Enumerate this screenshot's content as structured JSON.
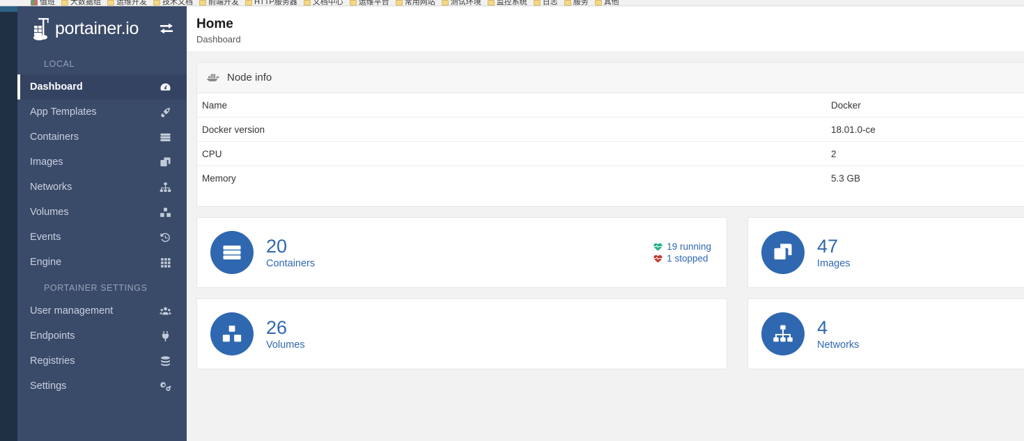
{
  "browser": {
    "bookmarks": [
      {
        "label": "值班",
        "icon": "multicolor-icon"
      },
      {
        "label": "大数据组",
        "icon": "folder-icon"
      },
      {
        "label": "运维开发",
        "icon": "folder-icon"
      },
      {
        "label": "技术文档",
        "icon": "folder-icon"
      },
      {
        "label": "前端开发",
        "icon": "folder-icon"
      },
      {
        "label": "HTTP服务器",
        "icon": "folder-icon"
      },
      {
        "label": "文档中心",
        "icon": "folder-icon"
      },
      {
        "label": "运维平台",
        "icon": "folder-icon"
      },
      {
        "label": "常用网站",
        "icon": "folder-icon"
      },
      {
        "label": "测试环境",
        "icon": "folder-icon"
      },
      {
        "label": "监控系统",
        "icon": "folder-icon"
      },
      {
        "label": "日志",
        "icon": "folder-icon"
      },
      {
        "label": "服务",
        "icon": "folder-icon"
      },
      {
        "label": "其他",
        "icon": "folder-icon"
      }
    ]
  },
  "sidebar": {
    "brand": "portainer.io",
    "toggle_icon": "exchange-arrows-icon",
    "sections": [
      {
        "title": "LOCAL",
        "items": [
          {
            "label": "Dashboard",
            "icon": "tachometer-icon",
            "active": true
          },
          {
            "label": "App Templates",
            "icon": "rocket-icon",
            "active": false
          },
          {
            "label": "Containers",
            "icon": "server-stack-icon",
            "active": false
          },
          {
            "label": "Images",
            "icon": "clone-icon",
            "active": false
          },
          {
            "label": "Networks",
            "icon": "sitemap-icon",
            "active": false
          },
          {
            "label": "Volumes",
            "icon": "cubes-icon",
            "active": false
          },
          {
            "label": "Events",
            "icon": "history-icon",
            "active": false
          },
          {
            "label": "Engine",
            "icon": "grid-icon",
            "active": false
          }
        ]
      },
      {
        "title": "PORTAINER SETTINGS",
        "items": [
          {
            "label": "User management",
            "icon": "users-icon",
            "active": false
          },
          {
            "label": "Endpoints",
            "icon": "plug-icon",
            "active": false
          },
          {
            "label": "Registries",
            "icon": "database-icon",
            "active": false
          },
          {
            "label": "Settings",
            "icon": "cogs-icon",
            "active": false
          }
        ]
      }
    ]
  },
  "header": {
    "title": "Home",
    "breadcrumb": "Dashboard"
  },
  "node_info": {
    "panel_title": "Node info",
    "panel_icon": "docker-whale-icon",
    "rows": [
      {
        "key": "Name",
        "value": "Docker"
      },
      {
        "key": "Docker version",
        "value": "18.01.0-ce"
      },
      {
        "key": "CPU",
        "value": "2"
      },
      {
        "key": "Memory",
        "value": "5.3 GB"
      }
    ]
  },
  "cards": [
    {
      "count": "20",
      "label": "Containers",
      "icon": "server-stack-icon",
      "status": [
        {
          "text": "19 running",
          "icon": "heartbeat-icon",
          "color": "#23ae89"
        },
        {
          "text": "1 stopped",
          "icon": "heartbeat-icon",
          "color": "#c0392b"
        }
      ]
    },
    {
      "count": "47",
      "label": "Images",
      "icon": "clone-icon",
      "status": []
    },
    {
      "count": "26",
      "label": "Volumes",
      "icon": "cubes-icon",
      "status": []
    },
    {
      "count": "4",
      "label": "Networks",
      "icon": "sitemap-icon",
      "status": []
    }
  ],
  "colors": {
    "sidebar_bg": "#3a4a69",
    "rail_bg": "#1f3044",
    "accent_blue": "#2f68b0",
    "page_bg": "#f2f2f2",
    "running_green": "#23ae89",
    "stopped_red": "#c0392b"
  }
}
